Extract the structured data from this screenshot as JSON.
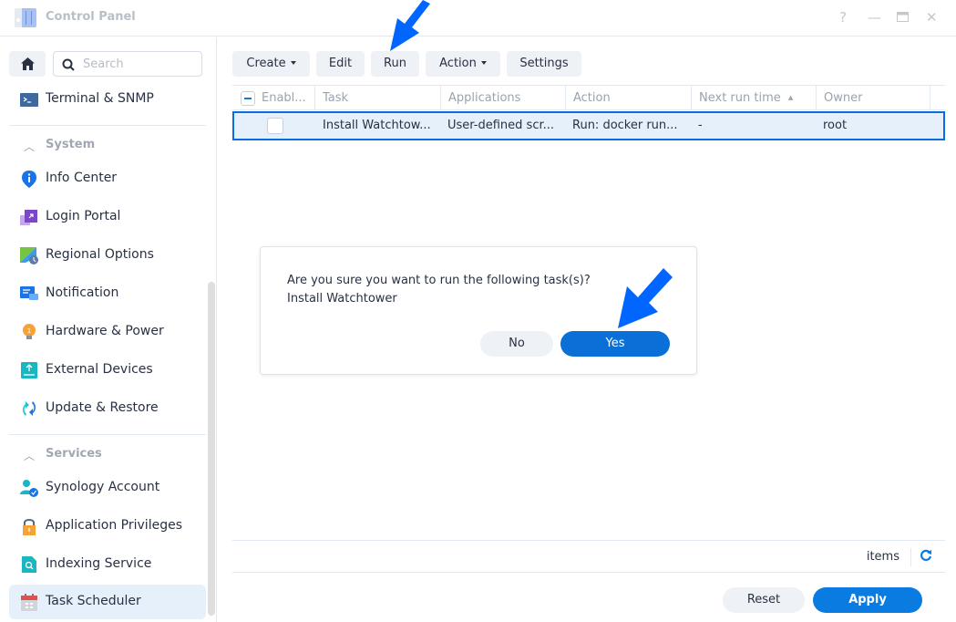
{
  "window": {
    "title": "Control Panel",
    "controls": {
      "help": "?",
      "minimize": "—",
      "maximize": "▭",
      "close": "✕"
    }
  },
  "sidebar": {
    "search_placeholder": "Search",
    "top_items": [
      {
        "label": "Terminal & SNMP",
        "icon": "terminal-icon"
      }
    ],
    "sections": [
      {
        "title": "System",
        "items": [
          {
            "label": "Info Center",
            "icon": "info-icon"
          },
          {
            "label": "Login Portal",
            "icon": "login-portal-icon"
          },
          {
            "label": "Regional Options",
            "icon": "regional-options-icon"
          },
          {
            "label": "Notification",
            "icon": "notification-icon"
          },
          {
            "label": "Hardware & Power",
            "icon": "lightbulb-icon"
          },
          {
            "label": "External Devices",
            "icon": "external-device-icon"
          },
          {
            "label": "Update & Restore",
            "icon": "update-icon"
          }
        ]
      },
      {
        "title": "Services",
        "items": [
          {
            "label": "Synology Account",
            "icon": "account-icon"
          },
          {
            "label": "Application Privileges",
            "icon": "lock-icon"
          },
          {
            "label": "Indexing Service",
            "icon": "indexing-icon"
          },
          {
            "label": "Task Scheduler",
            "icon": "calendar-icon",
            "active": true
          }
        ]
      }
    ]
  },
  "toolbar": {
    "create": "Create",
    "edit": "Edit",
    "run": "Run",
    "action": "Action",
    "settings": "Settings"
  },
  "grid": {
    "columns": [
      "Enabl...",
      "Task",
      "Applications",
      "Action",
      "Next run time",
      "Owner"
    ],
    "sort_indicator": "▲",
    "rows": [
      {
        "enabled": false,
        "task": "Install Watchtow...",
        "applications": "User-defined scr...",
        "action": "Run: docker run...",
        "next_run_time": "-",
        "owner": "root",
        "selected": true
      }
    ]
  },
  "pager": {
    "items_label": "items"
  },
  "footer": {
    "reset": "Reset",
    "apply": "Apply"
  },
  "dialog": {
    "message": "Are you sure you want to run the following task(s)?",
    "task_name": "Install Watchtower",
    "no": "No",
    "yes": "Yes"
  },
  "annotation_color": "#0066ff"
}
